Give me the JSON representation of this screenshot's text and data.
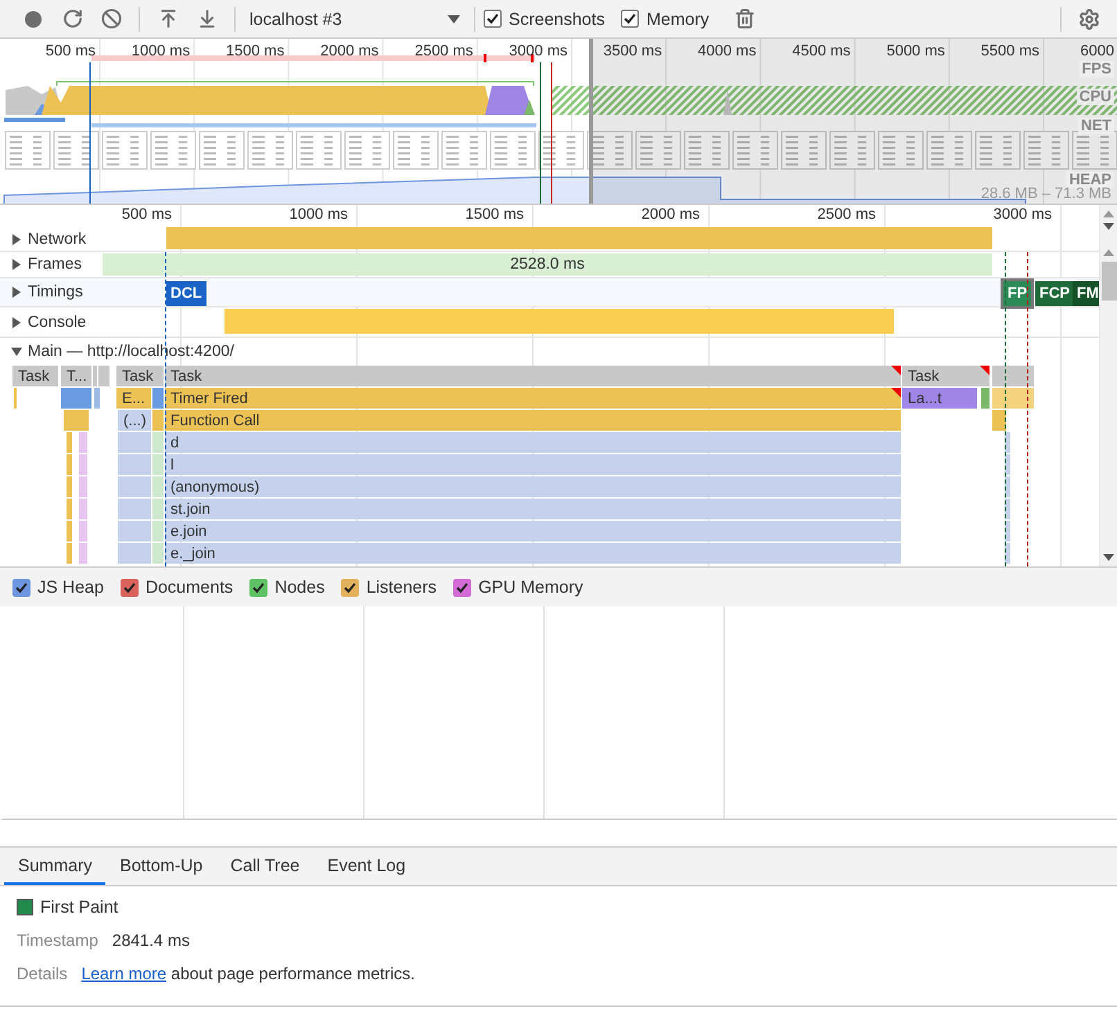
{
  "toolbar": {
    "profile_select": "localhost #3",
    "checkboxes": [
      {
        "label": "Screenshots",
        "checked": true
      },
      {
        "label": "Memory",
        "checked": true
      }
    ]
  },
  "overview": {
    "ticks": [
      "500 ms",
      "1000 ms",
      "1500 ms",
      "2000 ms",
      "2500 ms",
      "3000 ms",
      "3500 ms",
      "4000 ms",
      "4500 ms",
      "5000 ms",
      "5500 ms",
      "6000"
    ],
    "track_labels": [
      "FPS",
      "CPU",
      "NET",
      "HEAP"
    ],
    "heap_range": "28.6 MB – 71.3 MB"
  },
  "timeline": {
    "ticks": [
      "500 ms",
      "1000 ms",
      "1500 ms",
      "2000 ms",
      "2500 ms",
      "3000 ms"
    ],
    "tracks": [
      {
        "label": "Network",
        "expanded": false
      },
      {
        "label": "Frames",
        "expanded": false
      },
      {
        "label": "Timings",
        "expanded": false
      },
      {
        "label": "Console",
        "expanded": false
      }
    ],
    "frames_duration": "2528.0 ms",
    "timing_markers": [
      {
        "label": "DCL",
        "color": "#1a62c6",
        "selected": false
      },
      {
        "label": "FP",
        "color": "#2b8a55",
        "selected": true
      },
      {
        "label": "FCP",
        "color": "#1e6b39",
        "selected": false
      },
      {
        "label": "FM",
        "color": "#15522a",
        "selected": false
      }
    ],
    "main": {
      "title": "Main — http://localhost:4200/",
      "expanded": true
    },
    "flame_rows": [
      [
        {
          "label": "Task",
          "color": "#c8c8c8",
          "long": false
        },
        {
          "label": "T...",
          "color": "#c8c8c8",
          "long": false
        },
        {
          "label": "Task",
          "color": "#c8c8c8",
          "long": false
        },
        {
          "label": "Task",
          "color": "#c8c8c8",
          "long": true
        },
        {
          "label": "Task",
          "color": "#c8c8c8",
          "long": true
        }
      ],
      [
        {
          "label": "E...",
          "color": "#ecc254",
          "long": false
        },
        {
          "label": "Timer Fired",
          "color": "#ecc254",
          "long": true
        },
        {
          "label": "La...t",
          "color": "#9e85e6",
          "long": false
        }
      ],
      [
        {
          "label": "(...)",
          "color": "#c6d2ec",
          "long": false
        },
        {
          "label": "Function Call",
          "color": "#ecc254",
          "long": false
        }
      ],
      [
        {
          "label": "d",
          "color": "#c6d2ec",
          "long": false
        }
      ],
      [
        {
          "label": "l",
          "color": "#c6d2ec",
          "long": false
        }
      ],
      [
        {
          "label": "(anonymous)",
          "color": "#c6d2ec",
          "long": false
        }
      ],
      [
        {
          "label": "st.join",
          "color": "#c6d2ec",
          "long": false
        }
      ],
      [
        {
          "label": "e.join",
          "color": "#c6d2ec",
          "long": false
        }
      ],
      [
        {
          "label": "e._join",
          "color": "#c6d2ec",
          "long": false
        }
      ]
    ]
  },
  "memory_counters": [
    {
      "label": "JS Heap",
      "checked": true,
      "color": "#6d95e0"
    },
    {
      "label": "Documents",
      "checked": true,
      "color": "#d9635c"
    },
    {
      "label": "Nodes",
      "checked": true,
      "color": "#5ec264"
    },
    {
      "label": "Listeners",
      "checked": true,
      "color": "#e2b25c"
    },
    {
      "label": "GPU Memory",
      "checked": true,
      "color": "#d46ad6"
    }
  ],
  "detail_tabs": [
    {
      "label": "Summary",
      "selected": true
    },
    {
      "label": "Bottom-Up",
      "selected": false
    },
    {
      "label": "Call Tree",
      "selected": false
    },
    {
      "label": "Event Log",
      "selected": false
    }
  ],
  "summary": {
    "title": "First Paint",
    "color": "#1f8a4c",
    "rows": [
      {
        "label": "Timestamp",
        "value": "2841.4 ms"
      }
    ],
    "details_label": "Details",
    "link": "Learn more",
    "details_text": "about page performance metrics."
  }
}
